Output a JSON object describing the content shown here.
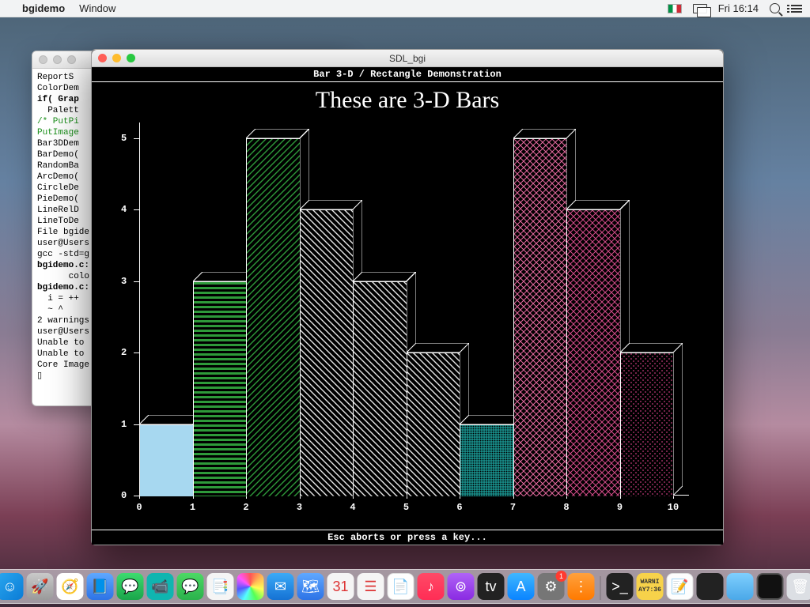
{
  "menubar": {
    "app": "bgidemo",
    "menus": [
      "Window"
    ],
    "clock": "Fri 16:14"
  },
  "terminal": {
    "lines": [
      {
        "t": "ReportS"
      },
      {
        "t": ""
      },
      {
        "t": "ColorDem"
      },
      {
        "t": "if( Grap",
        "cls": "bold"
      },
      {
        "t": "  Palett"
      },
      {
        "t": "/* PutPi",
        "cls": "grn"
      },
      {
        "t": "PutImage",
        "cls": "grn"
      },
      {
        "t": "Bar3DDem"
      },
      {
        "t": "BarDemo("
      },
      {
        "t": "RandomBa"
      },
      {
        "t": "ArcDemo("
      },
      {
        "t": "CircleDe"
      },
      {
        "t": "PieDemo("
      },
      {
        "t": "LineRelD"
      },
      {
        "t": "LineToDe"
      },
      {
        "t": "File bgide"
      },
      {
        "t": "user@Users"
      },
      {
        "t": "gcc -std=g"
      },
      {
        "t": "bgidemo.c:",
        "cls": "bold"
      },
      {
        "t": "      colo"
      },
      {
        "t": ""
      },
      {
        "t": "bgidemo.c:",
        "cls": "bold"
      },
      {
        "t": "  i = ++"
      },
      {
        "t": "  ~ ^"
      },
      {
        "t": "2 warnings"
      },
      {
        "t": "user@Users"
      },
      {
        "t": "Unable to "
      },
      {
        "t": "Unable to "
      },
      {
        "t": "Core Image"
      },
      {
        "t": "▯"
      }
    ]
  },
  "bgi": {
    "window_title": "SDL_bgi",
    "header": "Bar 3-D / Rectangle Demonstration",
    "title": "These are 3-D Bars",
    "footer": "Esc aborts or press a key..."
  },
  "chart_data": {
    "type": "bar",
    "title": "These are 3-D Bars",
    "xlabel": "",
    "ylabel": "",
    "ylim": [
      0,
      5
    ],
    "y_ticks": [
      0,
      1,
      2,
      3,
      4,
      5
    ],
    "x_ticks": [
      0,
      1,
      2,
      3,
      4,
      5,
      6,
      7,
      8,
      9,
      10
    ],
    "bars": [
      {
        "x": 1,
        "value": 1,
        "pattern": "solid",
        "color": "#a7d8f0"
      },
      {
        "x": 2,
        "value": 3,
        "pattern": "hstripe",
        "color": "#2e9a3a"
      },
      {
        "x": 3,
        "value": 5,
        "pattern": "diagA",
        "color": "#2e9a3a"
      },
      {
        "x": 4,
        "value": 4,
        "pattern": "diagB",
        "color": "#e8e8e8"
      },
      {
        "x": 5,
        "value": 3,
        "pattern": "diagB",
        "color": "#e8e8e8"
      },
      {
        "x": 6,
        "value": 2,
        "pattern": "diagB",
        "color": "#e8e8e8"
      },
      {
        "x": 7,
        "value": 1,
        "pattern": "grid",
        "color": "#1fb5b0"
      },
      {
        "x": 8,
        "value": 5,
        "pattern": "cross",
        "color": "#e66aa0"
      },
      {
        "x": 9,
        "value": 4,
        "pattern": "cross",
        "color": "#d44b8a"
      },
      {
        "x": 10,
        "value": 2,
        "pattern": "dots",
        "color": "#c23a7a"
      }
    ]
  },
  "dock": {
    "items": [
      {
        "name": "finder",
        "cls": "di-finder",
        "glyph": "☺"
      },
      {
        "name": "launchpad",
        "cls": "di-gray",
        "glyph": "🚀"
      },
      {
        "name": "safari",
        "cls": "di-safari",
        "glyph": "🧭"
      },
      {
        "name": "notes-app",
        "cls": "di-blue",
        "glyph": "📘"
      },
      {
        "name": "messages",
        "cls": "di-green",
        "glyph": "💬"
      },
      {
        "name": "facetime",
        "cls": "di-teal",
        "glyph": "📹"
      },
      {
        "name": "imessage",
        "cls": "di-msg",
        "glyph": "💬"
      },
      {
        "name": "stickies",
        "cls": "di-white",
        "glyph": "📑"
      },
      {
        "name": "photos",
        "cls": "di-rainbow",
        "glyph": ""
      },
      {
        "name": "mail",
        "cls": "di-mail",
        "glyph": "✉"
      },
      {
        "name": "maps",
        "cls": "di-blue",
        "glyph": "🗺"
      },
      {
        "name": "calendar",
        "cls": "di-white",
        "glyph": "31"
      },
      {
        "name": "reminders",
        "cls": "di-white",
        "glyph": "☰"
      },
      {
        "name": "pages",
        "cls": "di-pages",
        "glyph": "📄"
      },
      {
        "name": "music",
        "cls": "di-music",
        "glyph": "♪"
      },
      {
        "name": "podcasts",
        "cls": "di-pod",
        "glyph": "⊚"
      },
      {
        "name": "tv",
        "cls": "di-dark",
        "glyph": "tv"
      },
      {
        "name": "appstore",
        "cls": "di-app",
        "glyph": "A"
      },
      {
        "name": "preferences",
        "cls": "di-pref",
        "glyph": "⚙",
        "badge": "1"
      },
      {
        "name": "shortcuts",
        "cls": "di-orange",
        "glyph": "⋮"
      }
    ],
    "right_items": [
      {
        "name": "terminal1",
        "cls": "di-dark",
        "glyph": ">_"
      },
      {
        "name": "console",
        "cls": "di-yellow",
        "glyph": "WARNI\nAY7:36"
      },
      {
        "name": "textedit",
        "cls": "di-paper",
        "glyph": "📝"
      },
      {
        "name": "terminal2",
        "cls": "di-dark",
        "glyph": ""
      },
      {
        "name": "downloads",
        "cls": "di-folder",
        "glyph": ""
      },
      {
        "name": "display",
        "cls": "di-screen",
        "glyph": ""
      },
      {
        "name": "trash",
        "cls": "di-trash",
        "glyph": "🗑"
      }
    ]
  }
}
